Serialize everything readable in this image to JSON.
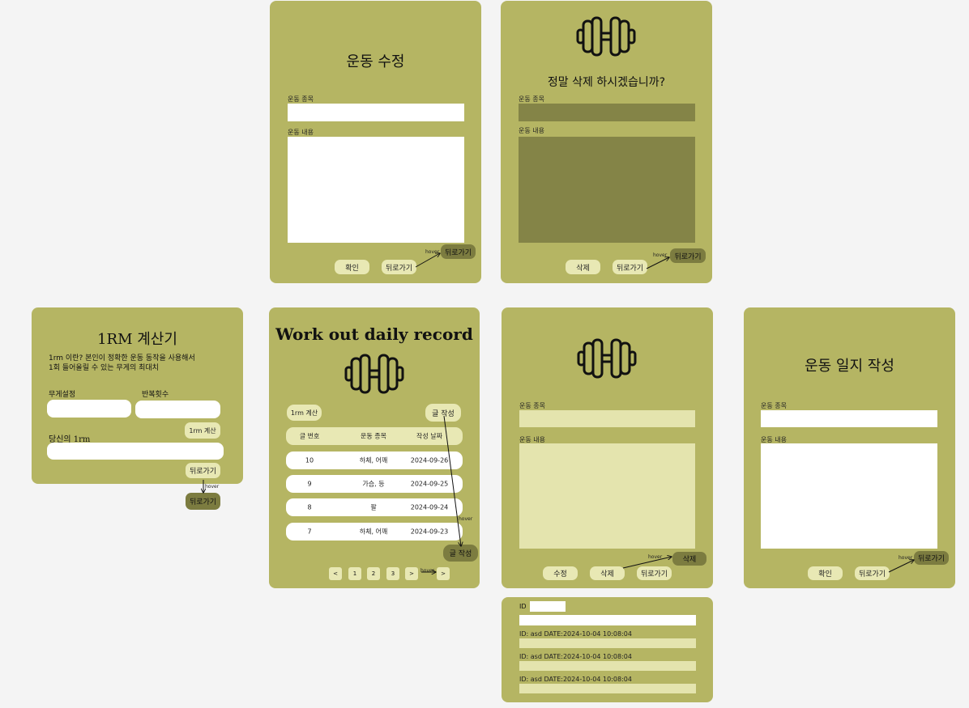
{
  "edit_screen": {
    "title": "운동 수정",
    "type_label": "운동 종목",
    "content_label": "운동 내용",
    "confirm_button": "확인",
    "back_button": "뒤로가기",
    "hover_label": "hover",
    "hover_button": "뒤로가기"
  },
  "delete_screen": {
    "icon": "dumbbell-icon",
    "title": "정말 삭제 하시겠습니까?",
    "type_label": "운동 종목",
    "content_label": "운동 내용",
    "delete_button": "삭제",
    "back_button": "뒤로가기",
    "hover_label": "hover",
    "hover_button": "뒤로가기"
  },
  "rm_screen": {
    "title": "1RM 계산기",
    "description_line1": "1rm 이란? 본인이 정확한 운동 동작을 사용해서",
    "description_line2": "1회 들어올릴 수 있는 무게의 최대치",
    "weight_label": "무게설정",
    "reps_label": "반복횟수",
    "calc_button": "1rm 계산",
    "result_label": "당신의 1rm",
    "back_button": "뒤로가기",
    "hover_label": "hover",
    "hover_button": "뒤로가기"
  },
  "main_screen": {
    "title": "Work out daily record",
    "icon": "dumbbell-icon",
    "rm_button": "1rm 계산",
    "write_button": "글 작성",
    "headers": [
      "글 번호",
      "운동 종목",
      "작성 날짜"
    ],
    "rows": [
      {
        "no": "10",
        "type": "하체, 어깨",
        "date": "2024-09-26"
      },
      {
        "no": "9",
        "type": "가슴, 등",
        "date": "2024-09-25"
      },
      {
        "no": "8",
        "type": "팔",
        "date": "2024-09-24"
      },
      {
        "no": "7",
        "type": "하체, 어깨",
        "date": "2024-09-23"
      }
    ],
    "hover_label": "hover",
    "hover_write_button": "글 작성",
    "pagination": [
      "<",
      "1",
      "2",
      "3",
      ">"
    ],
    "pagination_hover_label": "hover",
    "pagination_hover_button": ">"
  },
  "detail_screen": {
    "icon": "dumbbell-icon",
    "type_label": "운동 종목",
    "content_label": "운동 내용",
    "edit_button": "수정",
    "delete_button": "삭제",
    "back_button": "뒤로가기",
    "hover_label": "hover",
    "hover_button": "삭제"
  },
  "write_screen": {
    "title": "운동 일지 작성",
    "type_label": "운동 종목",
    "content_label": "운동 내용",
    "confirm_button": "확인",
    "back_button": "뒤로가기",
    "hover_label": "hover",
    "hover_button": "뒤로가기"
  },
  "comment_panel": {
    "id_label": "ID",
    "entries": [
      "ID: asd DATE:2024-10-04 10:08:04",
      "ID: asd DATE:2024-10-04 10:08:04",
      "ID: asd DATE:2024-10-04 10:08:04"
    ]
  },
  "colors": {
    "page_bg": "#f4f4f4",
    "card": "#b5b563",
    "button": "#e8e8b4",
    "button_hover": "#7c7c40",
    "field_dark": "#848447",
    "field_light": "#e4e4ae"
  }
}
